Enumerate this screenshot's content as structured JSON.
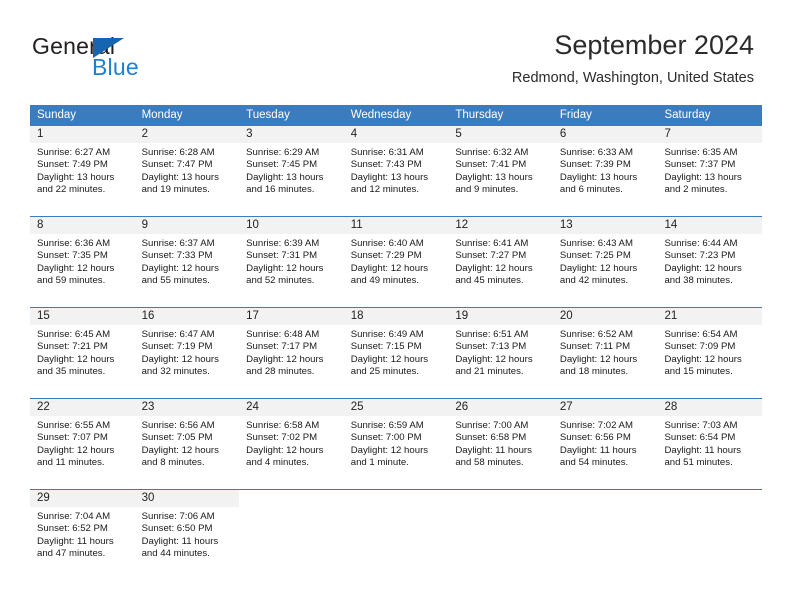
{
  "brand": {
    "name_top": "General",
    "name_bottom": "Blue",
    "accent_color": "#1f7fd0",
    "triangle_color": "#1565b0",
    "triangle_icon": "triangle-icon"
  },
  "header": {
    "title": "September 2024",
    "subtitle": "Redmond, Washington, United States"
  },
  "calendar": {
    "header_bg": "#3a7cbe",
    "day_band_bg": "#f2f2f2",
    "weekdays": [
      "Sunday",
      "Monday",
      "Tuesday",
      "Wednesday",
      "Thursday",
      "Friday",
      "Saturday"
    ],
    "weeks": [
      [
        {
          "day": "1",
          "sunrise": "Sunrise: 6:27 AM",
          "sunset": "Sunset: 7:49 PM",
          "daylight_1": "Daylight: 13 hours",
          "daylight_2": "and 22 minutes."
        },
        {
          "day": "2",
          "sunrise": "Sunrise: 6:28 AM",
          "sunset": "Sunset: 7:47 PM",
          "daylight_1": "Daylight: 13 hours",
          "daylight_2": "and 19 minutes."
        },
        {
          "day": "3",
          "sunrise": "Sunrise: 6:29 AM",
          "sunset": "Sunset: 7:45 PM",
          "daylight_1": "Daylight: 13 hours",
          "daylight_2": "and 16 minutes."
        },
        {
          "day": "4",
          "sunrise": "Sunrise: 6:31 AM",
          "sunset": "Sunset: 7:43 PM",
          "daylight_1": "Daylight: 13 hours",
          "daylight_2": "and 12 minutes."
        },
        {
          "day": "5",
          "sunrise": "Sunrise: 6:32 AM",
          "sunset": "Sunset: 7:41 PM",
          "daylight_1": "Daylight: 13 hours",
          "daylight_2": "and 9 minutes."
        },
        {
          "day": "6",
          "sunrise": "Sunrise: 6:33 AM",
          "sunset": "Sunset: 7:39 PM",
          "daylight_1": "Daylight: 13 hours",
          "daylight_2": "and 6 minutes."
        },
        {
          "day": "7",
          "sunrise": "Sunrise: 6:35 AM",
          "sunset": "Sunset: 7:37 PM",
          "daylight_1": "Daylight: 13 hours",
          "daylight_2": "and 2 minutes."
        }
      ],
      [
        {
          "day": "8",
          "sunrise": "Sunrise: 6:36 AM",
          "sunset": "Sunset: 7:35 PM",
          "daylight_1": "Daylight: 12 hours",
          "daylight_2": "and 59 minutes."
        },
        {
          "day": "9",
          "sunrise": "Sunrise: 6:37 AM",
          "sunset": "Sunset: 7:33 PM",
          "daylight_1": "Daylight: 12 hours",
          "daylight_2": "and 55 minutes."
        },
        {
          "day": "10",
          "sunrise": "Sunrise: 6:39 AM",
          "sunset": "Sunset: 7:31 PM",
          "daylight_1": "Daylight: 12 hours",
          "daylight_2": "and 52 minutes."
        },
        {
          "day": "11",
          "sunrise": "Sunrise: 6:40 AM",
          "sunset": "Sunset: 7:29 PM",
          "daylight_1": "Daylight: 12 hours",
          "daylight_2": "and 49 minutes."
        },
        {
          "day": "12",
          "sunrise": "Sunrise: 6:41 AM",
          "sunset": "Sunset: 7:27 PM",
          "daylight_1": "Daylight: 12 hours",
          "daylight_2": "and 45 minutes."
        },
        {
          "day": "13",
          "sunrise": "Sunrise: 6:43 AM",
          "sunset": "Sunset: 7:25 PM",
          "daylight_1": "Daylight: 12 hours",
          "daylight_2": "and 42 minutes."
        },
        {
          "day": "14",
          "sunrise": "Sunrise: 6:44 AM",
          "sunset": "Sunset: 7:23 PM",
          "daylight_1": "Daylight: 12 hours",
          "daylight_2": "and 38 minutes."
        }
      ],
      [
        {
          "day": "15",
          "sunrise": "Sunrise: 6:45 AM",
          "sunset": "Sunset: 7:21 PM",
          "daylight_1": "Daylight: 12 hours",
          "daylight_2": "and 35 minutes."
        },
        {
          "day": "16",
          "sunrise": "Sunrise: 6:47 AM",
          "sunset": "Sunset: 7:19 PM",
          "daylight_1": "Daylight: 12 hours",
          "daylight_2": "and 32 minutes."
        },
        {
          "day": "17",
          "sunrise": "Sunrise: 6:48 AM",
          "sunset": "Sunset: 7:17 PM",
          "daylight_1": "Daylight: 12 hours",
          "daylight_2": "and 28 minutes."
        },
        {
          "day": "18",
          "sunrise": "Sunrise: 6:49 AM",
          "sunset": "Sunset: 7:15 PM",
          "daylight_1": "Daylight: 12 hours",
          "daylight_2": "and 25 minutes."
        },
        {
          "day": "19",
          "sunrise": "Sunrise: 6:51 AM",
          "sunset": "Sunset: 7:13 PM",
          "daylight_1": "Daylight: 12 hours",
          "daylight_2": "and 21 minutes."
        },
        {
          "day": "20",
          "sunrise": "Sunrise: 6:52 AM",
          "sunset": "Sunset: 7:11 PM",
          "daylight_1": "Daylight: 12 hours",
          "daylight_2": "and 18 minutes."
        },
        {
          "day": "21",
          "sunrise": "Sunrise: 6:54 AM",
          "sunset": "Sunset: 7:09 PM",
          "daylight_1": "Daylight: 12 hours",
          "daylight_2": "and 15 minutes."
        }
      ],
      [
        {
          "day": "22",
          "sunrise": "Sunrise: 6:55 AM",
          "sunset": "Sunset: 7:07 PM",
          "daylight_1": "Daylight: 12 hours",
          "daylight_2": "and 11 minutes."
        },
        {
          "day": "23",
          "sunrise": "Sunrise: 6:56 AM",
          "sunset": "Sunset: 7:05 PM",
          "daylight_1": "Daylight: 12 hours",
          "daylight_2": "and 8 minutes."
        },
        {
          "day": "24",
          "sunrise": "Sunrise: 6:58 AM",
          "sunset": "Sunset: 7:02 PM",
          "daylight_1": "Daylight: 12 hours",
          "daylight_2": "and 4 minutes."
        },
        {
          "day": "25",
          "sunrise": "Sunrise: 6:59 AM",
          "sunset": "Sunset: 7:00 PM",
          "daylight_1": "Daylight: 12 hours",
          "daylight_2": "and 1 minute."
        },
        {
          "day": "26",
          "sunrise": "Sunrise: 7:00 AM",
          "sunset": "Sunset: 6:58 PM",
          "daylight_1": "Daylight: 11 hours",
          "daylight_2": "and 58 minutes."
        },
        {
          "day": "27",
          "sunrise": "Sunrise: 7:02 AM",
          "sunset": "Sunset: 6:56 PM",
          "daylight_1": "Daylight: 11 hours",
          "daylight_2": "and 54 minutes."
        },
        {
          "day": "28",
          "sunrise": "Sunrise: 7:03 AM",
          "sunset": "Sunset: 6:54 PM",
          "daylight_1": "Daylight: 11 hours",
          "daylight_2": "and 51 minutes."
        }
      ],
      [
        {
          "day": "29",
          "sunrise": "Sunrise: 7:04 AM",
          "sunset": "Sunset: 6:52 PM",
          "daylight_1": "Daylight: 11 hours",
          "daylight_2": "and 47 minutes."
        },
        {
          "day": "30",
          "sunrise": "Sunrise: 7:06 AM",
          "sunset": "Sunset: 6:50 PM",
          "daylight_1": "Daylight: 11 hours",
          "daylight_2": "and 44 minutes."
        },
        {
          "day": "",
          "sunrise": "",
          "sunset": "",
          "daylight_1": "",
          "daylight_2": ""
        },
        {
          "day": "",
          "sunrise": "",
          "sunset": "",
          "daylight_1": "",
          "daylight_2": ""
        },
        {
          "day": "",
          "sunrise": "",
          "sunset": "",
          "daylight_1": "",
          "daylight_2": ""
        },
        {
          "day": "",
          "sunrise": "",
          "sunset": "",
          "daylight_1": "",
          "daylight_2": ""
        },
        {
          "day": "",
          "sunrise": "",
          "sunset": "",
          "daylight_1": "",
          "daylight_2": ""
        }
      ]
    ]
  }
}
